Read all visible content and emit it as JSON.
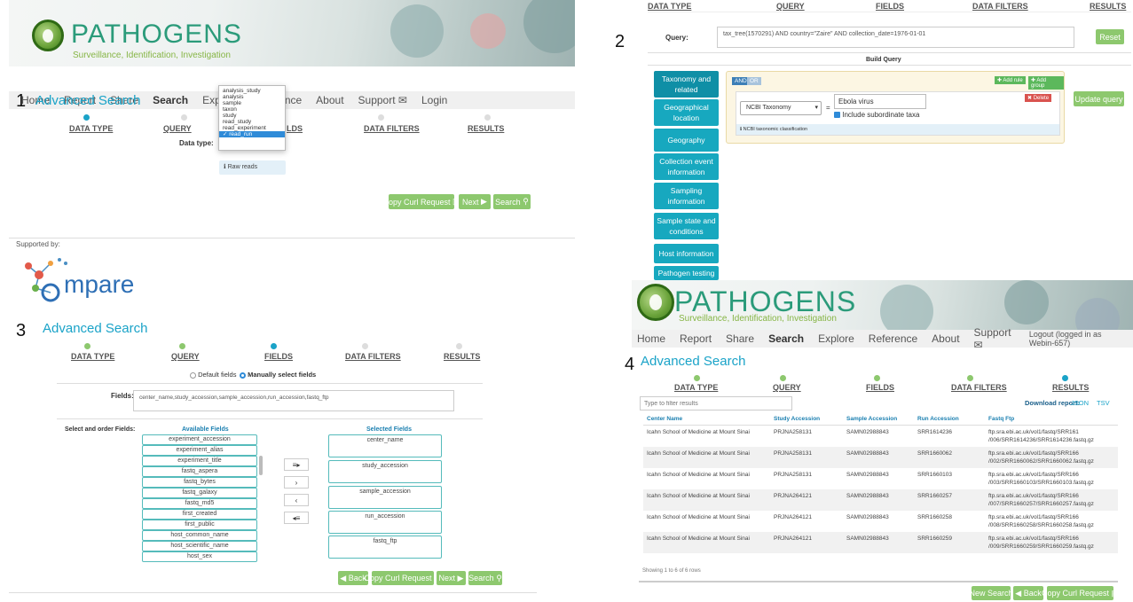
{
  "header": {
    "brand": "Pathogens",
    "tagline": "Surveillance, Identification, Investigation"
  },
  "nav": {
    "items": [
      "Home",
      "Report",
      "Share",
      "Search",
      "Explore",
      "Reference",
      "About",
      "Support",
      "Login"
    ],
    "items_logged": [
      "Home",
      "Report",
      "Share",
      "Search",
      "Explore",
      "Reference",
      "About",
      "Support",
      "Logout (logged in as Webin-657)"
    ]
  },
  "steps": [
    "DATA TYPE",
    "QUERY",
    "FIELDS",
    "DATA FILTERS",
    "RESULTS"
  ],
  "panel_numbers": [
    "1",
    "2",
    "3",
    "4"
  ],
  "p1": {
    "title": "Advanced Search",
    "data_type_label": "Data type:",
    "options": [
      "analysis_study",
      "analysis",
      "sample",
      "taxon",
      "study",
      "read_study",
      "read_experiment",
      "read_run"
    ],
    "selected": "✓ read_run",
    "info": "Raw reads",
    "buttons": [
      "Copy Curl Request",
      "Next",
      "Search"
    ],
    "supported_by": "Supported by:",
    "compare": "mpare"
  },
  "p2": {
    "query_label": "Query:",
    "query": "tax_tree(1570291) AND country=\"Zaire\" AND collection_date=1976-01-01",
    "reset": "Reset",
    "build": "Build Query",
    "categories": [
      "Taxonomy and related",
      "Geographical location",
      "Geography",
      "Collection event information",
      "Sampling information",
      "Sample state and conditions",
      "Host information",
      "Pathogen testing"
    ],
    "and": "AND",
    "or": "OR",
    "add_rule": "Add rule",
    "add_group": "Add group",
    "delete": "Delete",
    "field": "NCBI Taxonomy",
    "op": "=",
    "value": "Ebola virus",
    "include": "Include subordinate taxa",
    "hint": "NCBI taxonomic classification",
    "update": "Update query"
  },
  "p3": {
    "title": "Advanced Search",
    "default_fields": "Default fields",
    "manual_fields": "Manually select fields",
    "fields_label": "Fields:",
    "fields_value": "center_name,study_accession,sample_accession,run_accession,fastq_ftp",
    "select_label": "Select and order Fields:",
    "avail_title": "Available Fields",
    "sel_title": "Selected Fields",
    "available": [
      "experiment_accession",
      "experiment_alias",
      "experiment_title",
      "fastq_aspera",
      "fastq_bytes",
      "fastq_galaxy",
      "fastq_md5",
      "first_created",
      "first_public",
      "host_common_name",
      "host_scientific_name",
      "host_sex"
    ],
    "selected": [
      "center_name",
      "study_accession",
      "sample_accession",
      "run_accession",
      "fastq_ftp"
    ],
    "buttons": [
      "Back",
      "Copy Curl Request",
      "Next",
      "Search"
    ]
  },
  "p4": {
    "title": "Advanced Search",
    "filter_placeholder": "Type to filter results",
    "download": "Download report:",
    "json": "JSON",
    "tsv": "TSV",
    "columns": [
      "Center Name",
      "Study Accession",
      "Sample Accession",
      "Run Accession",
      "Fastq Ftp"
    ],
    "rows": [
      [
        "Icahn School of Medicine at Mount Sinai",
        "PRJNA258131",
        "SAMN02988843",
        "SRR1614236",
        "ftp.sra.ebi.ac.uk/vol1/fastq/SRR161",
        "/006/SRR1614236/SRR1614236.fastq.gz"
      ],
      [
        "Icahn School of Medicine at Mount Sinai",
        "PRJNA258131",
        "SAMN02988843",
        "SRR1660062",
        "ftp.sra.ebi.ac.uk/vol1/fastq/SRR166",
        "/002/SRR1660062/SRR1660062.fastq.gz"
      ],
      [
        "Icahn School of Medicine at Mount Sinai",
        "PRJNA258131",
        "SAMN02988843",
        "SRR1660103",
        "ftp.sra.ebi.ac.uk/vol1/fastq/SRR166",
        "/003/SRR1660103/SRR1660103.fastq.gz"
      ],
      [
        "Icahn School of Medicine at Mount Sinai",
        "PRJNA264121",
        "SAMN02988843",
        "SRR1660257",
        "ftp.sra.ebi.ac.uk/vol1/fastq/SRR166",
        "/007/SRR1660257/SRR1660257.fastq.gz"
      ],
      [
        "Icahn School of Medicine at Mount Sinai",
        "PRJNA264121",
        "SAMN02988843",
        "SRR1660258",
        "ftp.sra.ebi.ac.uk/vol1/fastq/SRR166",
        "/008/SRR1660258/SRR1660258.fastq.gz"
      ],
      [
        "Icahn School of Medicine at Mount Sinai",
        "PRJNA264121",
        "SAMN02988843",
        "SRR1660259",
        "ftp.sra.ebi.ac.uk/vol1/fastq/SRR166",
        "/009/SRR1660259/SRR1660259.fastq.gz"
      ]
    ],
    "showing": "Showing 1 to 6 of 6 rows",
    "buttons": [
      "New Search",
      "Back",
      "Copy Curl Request"
    ]
  },
  "colors": {
    "accent": "#1aa3c8",
    "green": "#8dc86e",
    "teal": "#17a8bf"
  }
}
